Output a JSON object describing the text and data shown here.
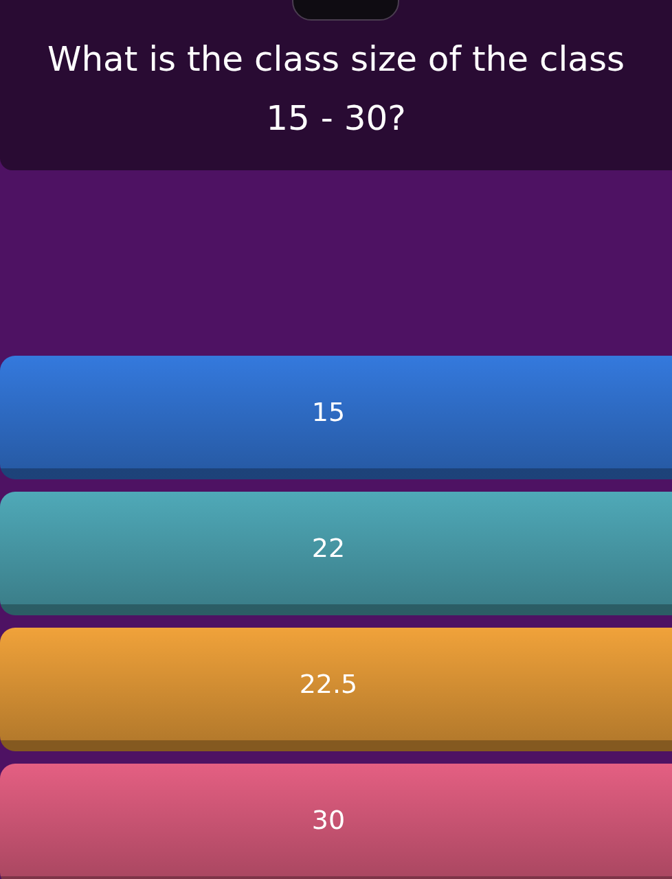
{
  "question": "What is the class size of the class 15 - 30?",
  "options": [
    {
      "label": "15",
      "color": "#3479dd"
    },
    {
      "label": "22",
      "color": "#4fa9b8"
    },
    {
      "label": "22.5",
      "color": "#f0a23a"
    },
    {
      "label": "30",
      "color": "#e45f82"
    }
  ]
}
